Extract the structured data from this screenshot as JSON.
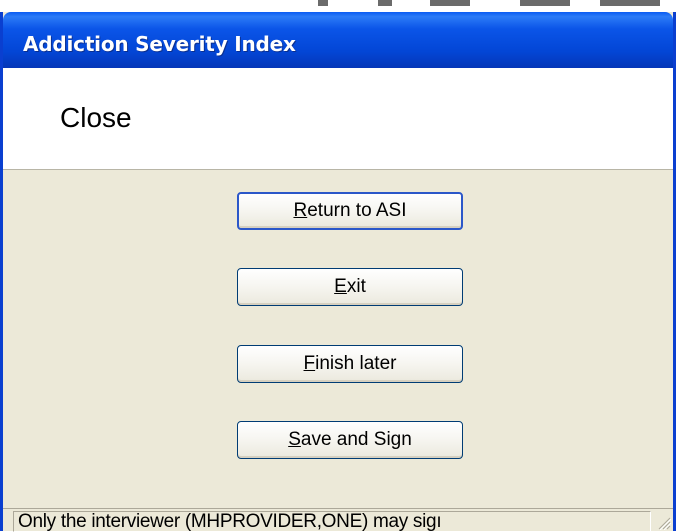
{
  "window": {
    "title": "Addiction Severity Index"
  },
  "header": {
    "title": "Close"
  },
  "buttons": {
    "return": {
      "mnemonic": "R",
      "rest": "eturn to ASI"
    },
    "exit": {
      "mnemonic": "E",
      "rest": "xit"
    },
    "finish_later": {
      "mnemonic": "F",
      "rest": "inish later"
    },
    "save_sign": {
      "mnemonic": "S",
      "rest": "ave and Sign"
    }
  },
  "status_bar": {
    "text": "Only the interviewer (MHPROVIDER,ONE) may sigı"
  },
  "colors": {
    "title_bar": "#0a5cf2",
    "dialog_face": "#ece9d8",
    "button_border": "#003c74"
  },
  "icons": {
    "size_grip": "resize-grip-icon"
  }
}
